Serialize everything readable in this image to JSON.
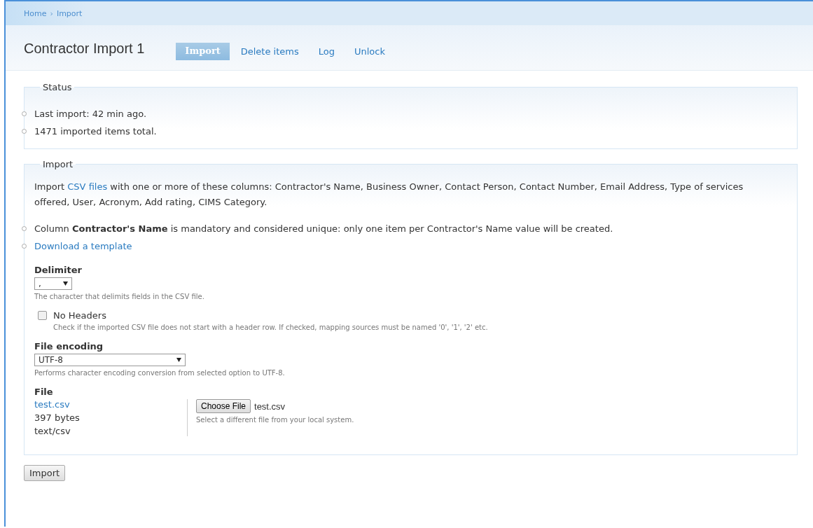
{
  "breadcrumb": [
    "Home",
    "Import"
  ],
  "breadcrumb_separator": "›",
  "page_title": "Contractor Import 1",
  "tabs": [
    {
      "label": "Import",
      "selected": true
    },
    {
      "label": "Delete items",
      "selected": false
    },
    {
      "label": "Log",
      "selected": false
    },
    {
      "label": "Unlock",
      "selected": false
    }
  ],
  "status": {
    "legend": "Status",
    "items": [
      "Last import: 42 min ago.",
      "1471 imported items total."
    ]
  },
  "import": {
    "legend": "Import",
    "intro": {
      "before": "Import",
      "link": "CSV files",
      "after": "with one or more of these columns: Contractor's Name, Business Owner, Contact Person, Contact Number, Email Address, Type of services offered, User, Acronym, Add rating, CIMS Category."
    },
    "list": [
      {
        "kind": "text",
        "text": "Column **Contractor's Name** is mandatory and considered unique: only one item per Contractor's Name value will be created."
      },
      {
        "kind": "link",
        "text": "Download a template"
      }
    ],
    "delimiter": {
      "label": "Delimiter",
      "value": ",",
      "description": "The character that delimits fields in the CSV file."
    },
    "no_headers": {
      "label": "No Headers",
      "checked": false,
      "description": "Check if the imported CSV file does not start with a header row. If checked, mapping sources must be named '0', '1', '2' etc."
    },
    "encoding": {
      "label": "File encoding",
      "value": "UTF-8",
      "description": "Performs character encoding conversion from selected option to UTF-8."
    },
    "file": {
      "label": "File",
      "name": "test.csv",
      "size": "397 bytes",
      "mime": "text/csv",
      "button": "Choose File",
      "chosen": "test.csv",
      "description": "Select a different file from your local system."
    }
  },
  "submit": "Import"
}
